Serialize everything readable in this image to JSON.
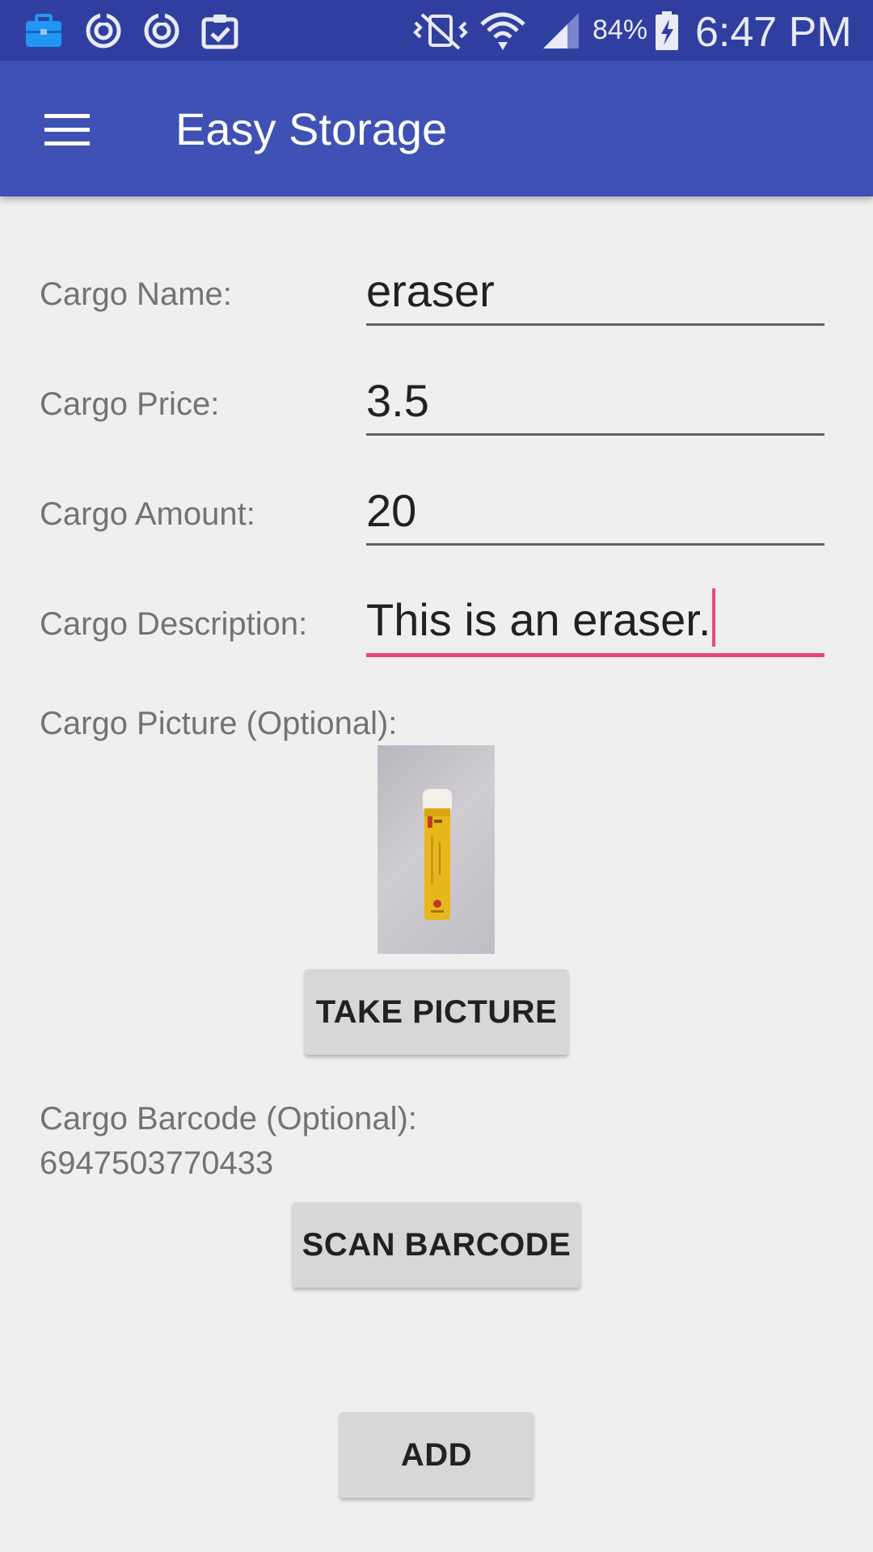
{
  "status_bar": {
    "battery": "84%",
    "time": "6:47 PM",
    "icons": [
      "briefcase-icon",
      "sync-icon",
      "sync-icon",
      "clipboard-check-icon",
      "vibrate-off-icon",
      "wifi-icon",
      "signal-icon",
      "battery-charging-icon"
    ]
  },
  "app_bar": {
    "title": "Easy Storage",
    "menu_icon": "hamburger-menu-icon"
  },
  "form": {
    "name_label": "Cargo Name:",
    "name_value": "eraser",
    "price_label": "Cargo Price:",
    "price_value": "3.5",
    "amount_label": "Cargo Amount:",
    "amount_value": "20",
    "description_label": "Cargo Description:",
    "description_value": "This is an eraser.",
    "picture_label": "Cargo Picture (Optional):",
    "take_picture_button": "TAKE PICTURE",
    "barcode_label": "Cargo Barcode (Optional):",
    "barcode_value": "6947503770433",
    "scan_barcode_button": "SCAN BARCODE",
    "add_button": "ADD"
  },
  "colors": {
    "status_bar": "#303f9f",
    "app_bar": "#3f51b5",
    "accent": "#f0457d",
    "background": "#efefef"
  }
}
